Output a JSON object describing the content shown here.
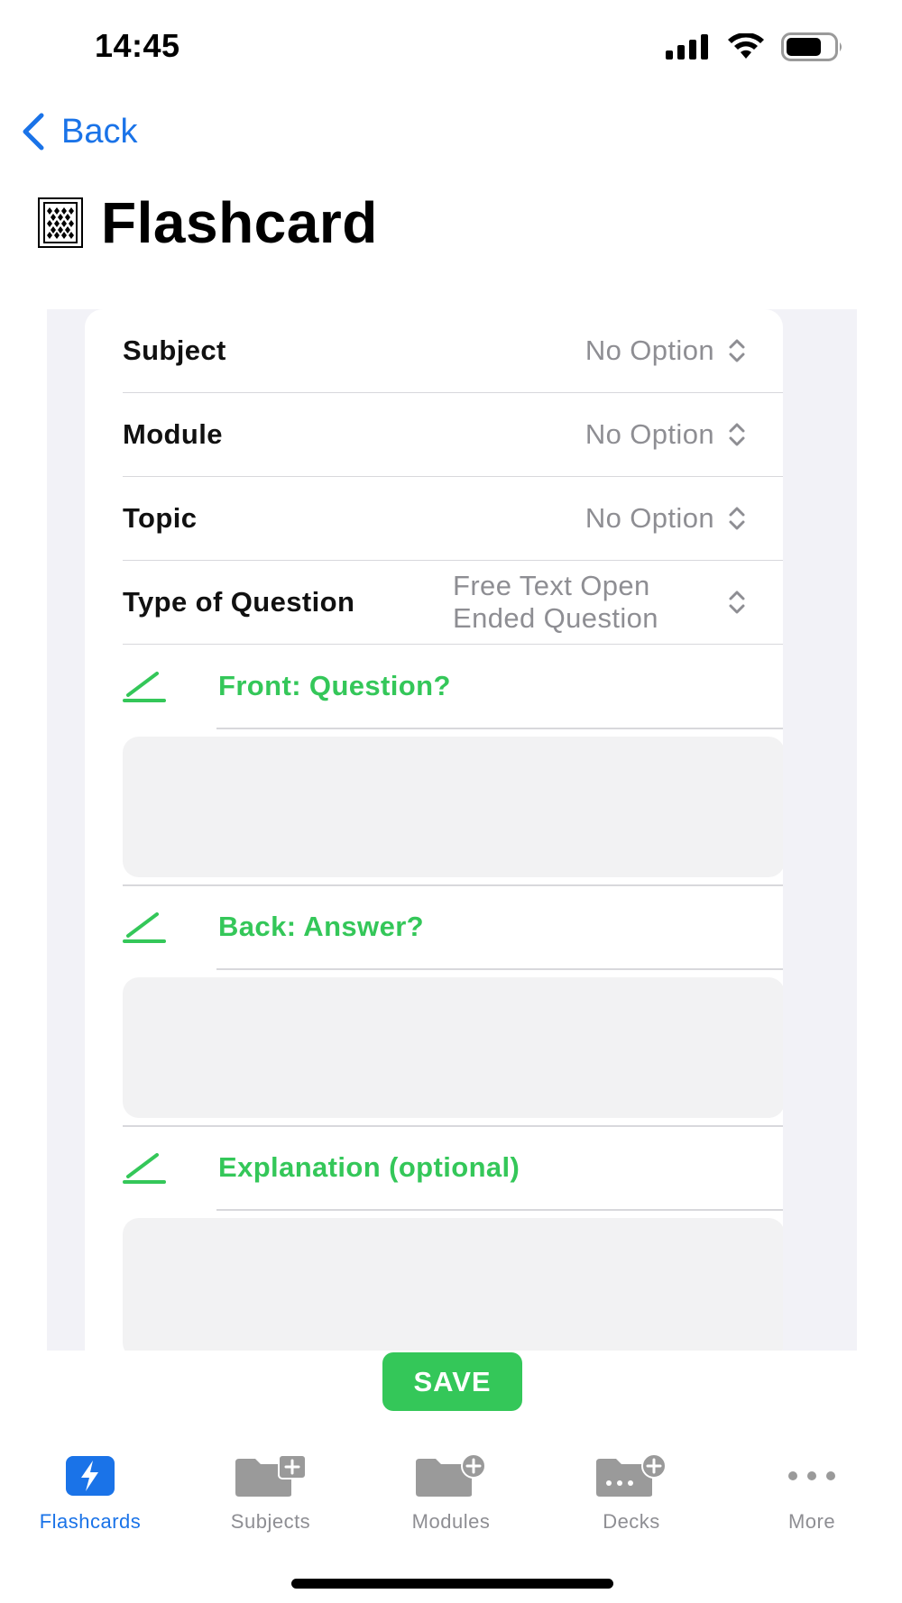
{
  "status_bar": {
    "time": "14:45",
    "icons": [
      "signal-icon",
      "wifi-icon",
      "battery-icon"
    ]
  },
  "nav": {
    "back_label": "Back"
  },
  "page": {
    "title": "Flashcard",
    "title_icon": "flashcard-icon"
  },
  "form": {
    "pickers": [
      {
        "label": "Subject",
        "value": "No Option"
      },
      {
        "label": "Module",
        "value": "No Option"
      },
      {
        "label": "Topic",
        "value": "No Option"
      },
      {
        "label": "Type of Question",
        "value_line1": "Free Text Open",
        "value_line2": "Ended Question"
      }
    ],
    "sections": [
      {
        "label": "Front: Question?",
        "value": ""
      },
      {
        "label": "Back: Answer?",
        "value": ""
      },
      {
        "label": "Explanation (optional)",
        "value": ""
      }
    ],
    "save_label": "SAVE"
  },
  "tabbar": {
    "tabs": [
      {
        "label": "Flashcards",
        "icon": "bolt-icon",
        "active": true
      },
      {
        "label": "Subjects",
        "icon": "folder-plus-icon",
        "active": false
      },
      {
        "label": "Modules",
        "icon": "folder-plus-circle-icon",
        "active": false
      },
      {
        "label": "Decks",
        "icon": "folder-dots-plus-icon",
        "active": false
      },
      {
        "label": "More",
        "icon": "more-dots-icon",
        "active": false
      }
    ]
  },
  "colors": {
    "accent_blue": "#1a73e8",
    "accent_green": "#34c759",
    "secondary_text": "#8e8e93",
    "field_bg": "#f2f2f3",
    "grouped_bg": "#f2f2f7"
  }
}
